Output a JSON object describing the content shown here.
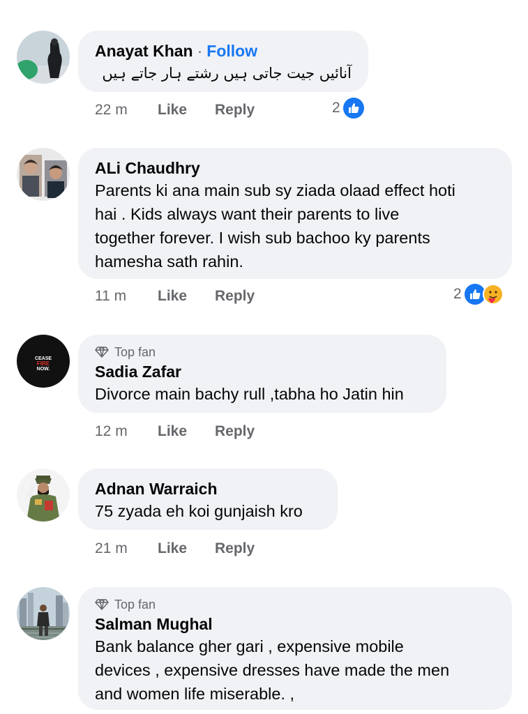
{
  "comments": [
    {
      "author": "Anayat Khan",
      "follow_label": "Follow",
      "separator": "·",
      "text": "آنائیں جیت جاتی ہیں رشتے ہار جاتے ہیں",
      "time": "22 m",
      "like_label": "Like",
      "reply_label": "Reply",
      "reaction_count": "2",
      "reactions": [
        "like-icon"
      ]
    },
    {
      "author": "ALi Chaudhry",
      "text_lines": [
        "Parents ki ana main sub sy ziada olaad effect hoti",
        "hai . Kids always want their parents to live",
        "together forever. I wish sub bachoo ky parents",
        "hamesha sath rahin."
      ],
      "time": "11 m",
      "like_label": "Like",
      "reply_label": "Reply",
      "reaction_count": "2",
      "reactions": [
        "like-icon",
        "care-icon"
      ]
    },
    {
      "badge": "Top fan",
      "author": "Sadia Zafar",
      "text": "Divorce main bachy rull ,tabha ho Jatin hin",
      "time": "12 m",
      "like_label": "Like",
      "reply_label": "Reply",
      "avatar_text": [
        "CEASE",
        "FIRE",
        "NOW."
      ]
    },
    {
      "author": "Adnan Warraich",
      "text": "75 zyada eh koi gunjaish kro",
      "time": "21 m",
      "like_label": "Like",
      "reply_label": "Reply"
    },
    {
      "badge": "Top fan",
      "author": "Salman Mughal",
      "text_lines": [
        "Bank balance gher gari , expensive mobile",
        "devices , expensive dresses have made the men",
        "and women life miserable. ,"
      ]
    }
  ],
  "colors": {
    "bubble": "#f0f2f5",
    "link": "#1877f2",
    "meta": "#65676b"
  }
}
